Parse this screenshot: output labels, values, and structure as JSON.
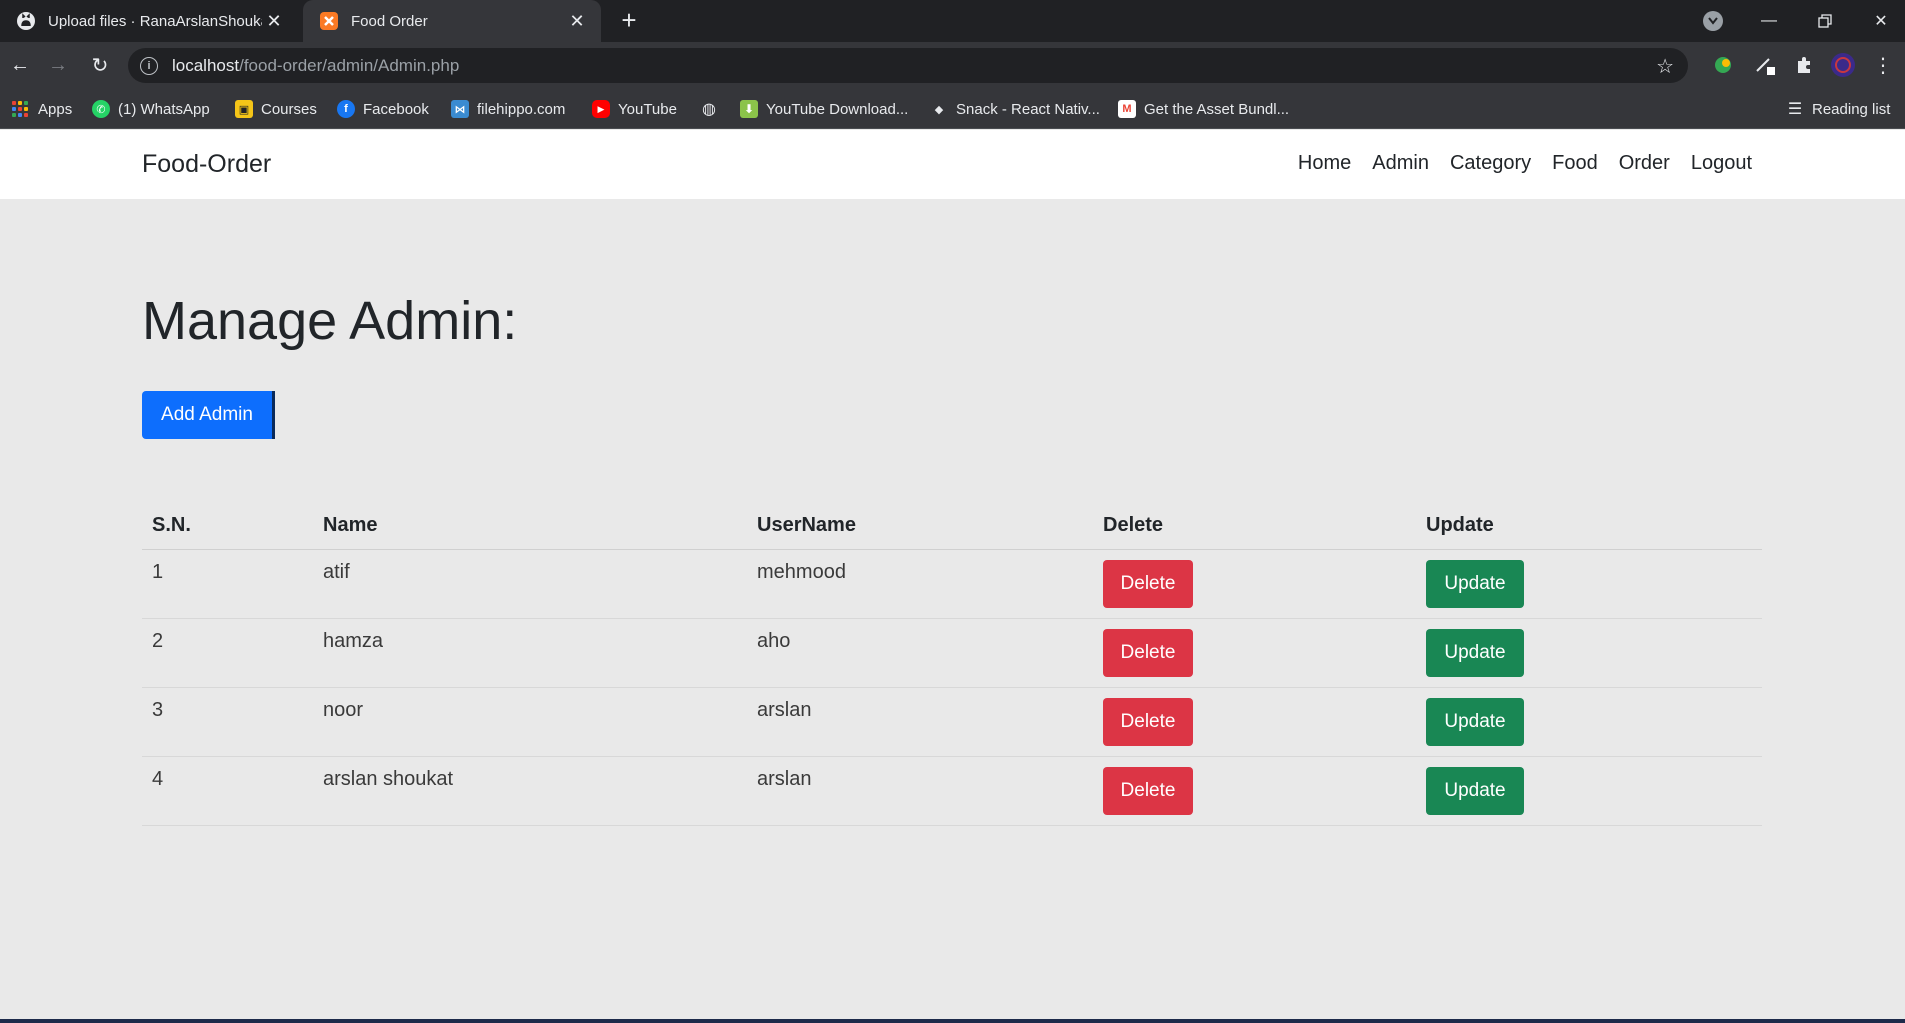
{
  "browser": {
    "tabs": [
      {
        "title": "Upload files · RanaArslanShoukat",
        "active": false
      },
      {
        "title": "Food Order",
        "active": true
      }
    ],
    "url_host": "localhost",
    "url_path": "/food-order/admin/Admin.php",
    "bookmarks": [
      {
        "label": "Apps",
        "icon": "apps-grid-icon"
      },
      {
        "label": "(1) WhatsApp",
        "icon": "whatsapp-icon"
      },
      {
        "label": "Courses",
        "icon": "courses-icon"
      },
      {
        "label": "Facebook",
        "icon": "facebook-icon"
      },
      {
        "label": "filehippo.com",
        "icon": "filehippo-icon"
      },
      {
        "label": "YouTube",
        "icon": "youtube-icon"
      },
      {
        "label": "",
        "icon": "globe-icon"
      },
      {
        "label": "YouTube Download...",
        "icon": "download-icon"
      },
      {
        "label": "Snack - React Nativ...",
        "icon": "snack-icon"
      },
      {
        "label": "Get the Asset Bundl...",
        "icon": "gmail-icon"
      }
    ],
    "reading_list": "Reading list"
  },
  "site": {
    "brand": "Food-Order",
    "nav": [
      "Home",
      "Admin",
      "Category",
      "Food",
      "Order",
      "Logout"
    ]
  },
  "main": {
    "title": "Manage Admin:",
    "add_button": "Add Admin",
    "table": {
      "headers": [
        "S.N.",
        "Name",
        "UserName",
        "Delete",
        "Update"
      ],
      "rows": [
        {
          "sn": "1",
          "name": "atif",
          "username": "mehmood",
          "delete": "Delete",
          "update": "Update"
        },
        {
          "sn": "2",
          "name": "hamza",
          "username": "aho",
          "delete": "Delete",
          "update": "Update"
        },
        {
          "sn": "3",
          "name": "noor",
          "username": "arslan",
          "delete": "Delete",
          "update": "Update"
        },
        {
          "sn": "4",
          "name": "arslan shoukat",
          "username": "arslan",
          "delete": "Delete",
          "update": "Update"
        }
      ]
    }
  },
  "colors": {
    "primary": "#0d6efd",
    "danger": "#dc3545",
    "success": "#198754",
    "page_bg": "#e9e9e9",
    "chrome_dark": "#202124"
  }
}
